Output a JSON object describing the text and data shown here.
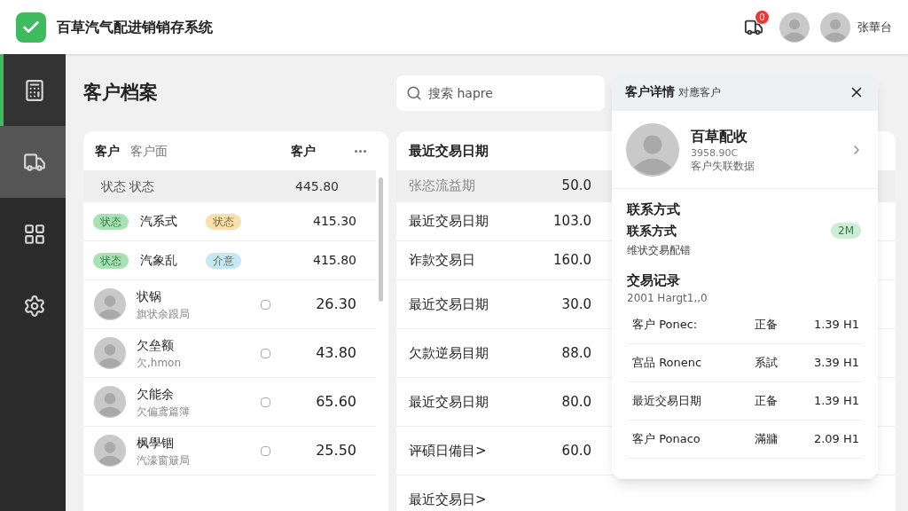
{
  "app": {
    "title": "百草汽气配进销销存系统",
    "notifications": "0",
    "user_name": "张華台"
  },
  "sidebar": {
    "items": [
      {
        "kind": "register",
        "selected": true,
        "hovered": false
      },
      {
        "kind": "truck",
        "selected": false,
        "hovered": true
      },
      {
        "kind": "grid",
        "selected": false,
        "hovered": false
      },
      {
        "kind": "settings",
        "selected": false,
        "hovered": false
      }
    ]
  },
  "page": {
    "title": "客户档案",
    "search": {
      "placeholder": "搜索 hapre"
    }
  },
  "customer_list": {
    "header": {
      "column_1": "客户",
      "column_2": "客户面",
      "column_3": "客户"
    },
    "rows": [
      {
        "kind": "plain",
        "label_1": "状态",
        "label_2": "状态",
        "amount": "445.80"
      },
      {
        "kind": "tagged",
        "tag_1": {
          "text": "状态",
          "color": "#a8e2b4"
        },
        "name": "汽系式",
        "tag_2": {
          "text": "状态",
          "color": "#f8dfab"
        },
        "amount": "415.30"
      },
      {
        "kind": "tagged",
        "tag_1": {
          "text": "状态",
          "color": "#a8e2b4"
        },
        "name": "汽象乱",
        "tag_2": {
          "text": "介意",
          "color": "#c4e8f4"
        },
        "amount": "415.80"
      },
      {
        "kind": "person",
        "name": "状锅",
        "subtitle": "旗状余跟局",
        "checked": false,
        "amount": "26.30"
      },
      {
        "kind": "person",
        "name": "欠垒额",
        "subtitle": "欠,hmon",
        "checked": false,
        "amount": "43.80"
      },
      {
        "kind": "person",
        "name": "欠能余",
        "subtitle": "欠偏鸢篇簿",
        "checked": false,
        "amount": "65.60"
      },
      {
        "kind": "person",
        "name": "枫學锢",
        "subtitle": "汽濠窗簸局",
        "checked": false,
        "amount": "25.50"
      }
    ]
  },
  "transactions": {
    "header": "最近交易日期",
    "rows": [
      {
        "label": "张恣流益期",
        "value": "50.0",
        "muted": true
      },
      {
        "label": "最近交易日期",
        "value": "103.0",
        "muted": false
      },
      {
        "label": "诈款交易日",
        "value": "160.0",
        "muted": false
      },
      {
        "label": "最近交易日期",
        "value": "30.0",
        "muted": false
      },
      {
        "label": "欠款逆易目期",
        "value": "88.0",
        "muted": false
      },
      {
        "label": "最近交易日期",
        "value": "80.0",
        "muted": false
      },
      {
        "label": "评碩日備目>",
        "value": "60.0",
        "muted": false
      },
      {
        "label": "最近交易日>",
        "muted": false
      }
    ]
  },
  "detail_panel": {
    "title": "客户详情",
    "subtitle": "对應客户",
    "profile": {
      "name": "百草配收",
      "code": "3958.90C",
      "note": "客户失联数据"
    },
    "contact": {
      "heading": "联系方式",
      "label": "联系方式",
      "badge": "2M",
      "detail": "维状交易配错"
    },
    "records": {
      "heading": "交易记录",
      "subtitle": "2001 Hargt1,,0",
      "rows": [
        {
          "name": "客户 Ponec:",
          "status": "正备",
          "amount": "1.39 H1"
        },
        {
          "name": "宫品 Ronenc",
          "status": "系試",
          "amount": "3.39 H1"
        },
        {
          "name": "最近交易日期",
          "status": "正备",
          "amount": "1.39 H1"
        },
        {
          "name": "客户 Ponaco",
          "status": "滿牅",
          "amount": "2.09 H1"
        }
      ]
    }
  }
}
